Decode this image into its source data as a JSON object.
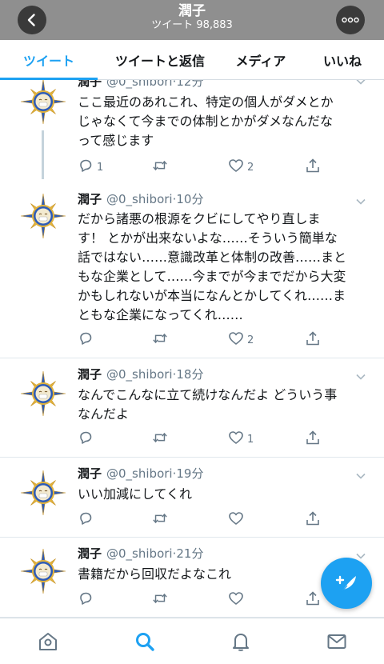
{
  "header": {
    "title": "潤子",
    "subtitle": "ツイート 98,883",
    "back_icon": "chevron-left-icon",
    "more_icon": "more-dots-icon"
  },
  "tabs": [
    {
      "label": "ツイート",
      "active": true
    },
    {
      "label": "ツイートと返信",
      "active": false
    },
    {
      "label": "メディア",
      "active": false
    },
    {
      "label": "いいね",
      "active": false
    }
  ],
  "colors": {
    "accent": "#1da1f2",
    "header_bg": "#8f8f8f",
    "secondary_text": "#657786",
    "divider": "#e1e8ed"
  },
  "tweets": [
    {
      "name": "潤子",
      "handle": "@0_shibori",
      "time": "·12分",
      "text": "ここ最近のあれこれ、特定の個人がダメとか\nじゃなくて今までの体制とかがダメなんだな\nって感じます",
      "replies": "1",
      "retweets": "",
      "likes": "2",
      "thread_continues": true
    },
    {
      "name": "潤子",
      "handle": "@0_shibori",
      "time": "·10分",
      "text": "だから諸悪の根源をクビにしてやり直しま\nす！ とかが出来ないよな……そういう簡単な\n話ではない……意識改革と体制の改善……まと\nもな企業として……今までが今までだから大変\nかもしれないが本当になんとかしてくれ……ま\nともな企業になってくれ……",
      "replies": "",
      "retweets": "",
      "likes": "2",
      "thread_continues": false
    },
    {
      "name": "潤子",
      "handle": "@0_shibori",
      "time": "·18分",
      "text": "なんでこんなに立て続けなんだよ どういう事\nなんだよ",
      "replies": "",
      "retweets": "",
      "likes": "1",
      "thread_continues": false
    },
    {
      "name": "潤子",
      "handle": "@0_shibori",
      "time": "·19分",
      "text": "いい加減にしてくれ",
      "replies": "",
      "retweets": "",
      "likes": "",
      "thread_continues": false
    },
    {
      "name": "潤子",
      "handle": "@0_shibori",
      "time": "·21分",
      "text": "書籍だから回収だよなこれ",
      "replies": "",
      "retweets": "",
      "likes": "",
      "thread_continues": false
    }
  ],
  "compose_button": {
    "icon": "compose-feather-icon"
  },
  "bottom_nav": [
    {
      "icon": "home-icon",
      "active": false
    },
    {
      "icon": "search-icon",
      "active": true
    },
    {
      "icon": "notifications-bell-icon",
      "active": false
    },
    {
      "icon": "messages-mail-icon",
      "active": false
    }
  ]
}
